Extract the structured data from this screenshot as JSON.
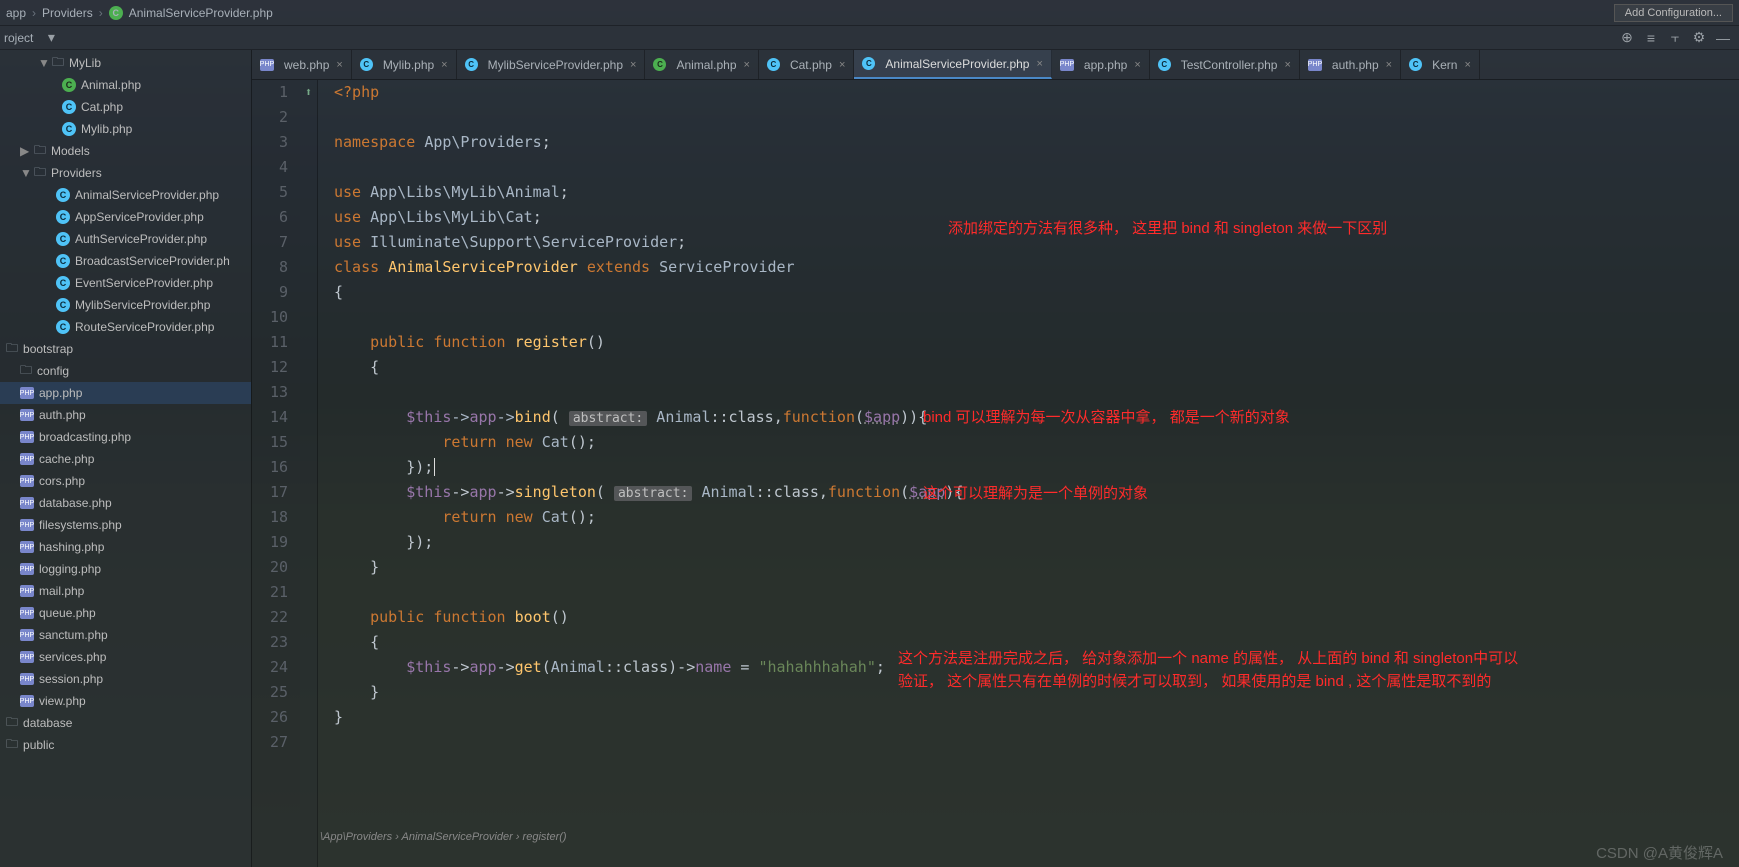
{
  "breadcrumb": {
    "p1": "app",
    "p2": "Providers",
    "p3": "AnimalServiceProvider.php"
  },
  "add_config": "Add Configuration...",
  "project_label": "roject",
  "toolbar_icons": [
    "target-icon",
    "bars-icon",
    "split-icon",
    "gear-icon",
    "hide-icon"
  ],
  "tree": [
    {
      "lvl": 2,
      "chev": "▼",
      "type": "folder",
      "label": "MyLib"
    },
    {
      "lvl": 4,
      "type": "c-green",
      "label": "Animal.php"
    },
    {
      "lvl": 4,
      "type": "c-blue",
      "label": "Cat.php"
    },
    {
      "lvl": 4,
      "type": "c-blue",
      "label": "Mylib.php"
    },
    {
      "lvl": 1,
      "chev": "▶",
      "type": "folder",
      "label": "Models"
    },
    {
      "lvl": 1,
      "chev": "▼",
      "type": "folder",
      "label": "Providers"
    },
    {
      "lvl": 3,
      "type": "c-blue",
      "label": "AnimalServiceProvider.php"
    },
    {
      "lvl": 3,
      "type": "c-blue",
      "label": "AppServiceProvider.php"
    },
    {
      "lvl": 3,
      "type": "c-blue",
      "label": "AuthServiceProvider.php"
    },
    {
      "lvl": 3,
      "type": "c-blue",
      "label": "BroadcastServiceProvider.ph"
    },
    {
      "lvl": 3,
      "type": "c-blue",
      "label": "EventServiceProvider.php"
    },
    {
      "lvl": 3,
      "type": "c-blue",
      "label": "MylibServiceProvider.php"
    },
    {
      "lvl": 3,
      "type": "c-blue",
      "label": "RouteServiceProvider.php"
    },
    {
      "lvl": 0,
      "type": "folder",
      "label": "bootstrap"
    },
    {
      "lvl": 0,
      "chev": "",
      "type": "folder",
      "label": "config"
    },
    {
      "lvl": 1,
      "type": "php",
      "label": "app.php",
      "sel": "cfg-selected"
    },
    {
      "lvl": 1,
      "type": "php",
      "label": "auth.php"
    },
    {
      "lvl": 1,
      "type": "php",
      "label": "broadcasting.php"
    },
    {
      "lvl": 1,
      "type": "php",
      "label": "cache.php"
    },
    {
      "lvl": 1,
      "type": "php",
      "label": "cors.php"
    },
    {
      "lvl": 1,
      "type": "php",
      "label": "database.php"
    },
    {
      "lvl": 1,
      "type": "php",
      "label": "filesystems.php"
    },
    {
      "lvl": 1,
      "type": "php",
      "label": "hashing.php"
    },
    {
      "lvl": 1,
      "type": "php",
      "label": "logging.php"
    },
    {
      "lvl": 1,
      "type": "php",
      "label": "mail.php"
    },
    {
      "lvl": 1,
      "type": "php",
      "label": "queue.php"
    },
    {
      "lvl": 1,
      "type": "php",
      "label": "sanctum.php"
    },
    {
      "lvl": 1,
      "type": "php",
      "label": "services.php"
    },
    {
      "lvl": 1,
      "type": "php",
      "label": "session.php"
    },
    {
      "lvl": 1,
      "type": "php",
      "label": "view.php"
    },
    {
      "lvl": 0,
      "type": "folder",
      "label": "database"
    },
    {
      "lvl": 0,
      "type": "folder",
      "label": "public"
    }
  ],
  "tabs": [
    {
      "icon": "php",
      "label": "web.php"
    },
    {
      "icon": "c-blue",
      "label": "Mylib.php"
    },
    {
      "icon": "c-blue",
      "label": "MylibServiceProvider.php"
    },
    {
      "icon": "c-green",
      "label": "Animal.php"
    },
    {
      "icon": "c-blue",
      "label": "Cat.php"
    },
    {
      "icon": "c-blue",
      "label": "AnimalServiceProvider.php",
      "active": true
    },
    {
      "icon": "php",
      "label": "app.php"
    },
    {
      "icon": "c-blue",
      "label": "TestController.php"
    },
    {
      "icon": "php",
      "label": "auth.php"
    },
    {
      "icon": "c-blue",
      "label": "Kern"
    }
  ],
  "code": {
    "lines": 27,
    "l1_kw": "<?php",
    "l3_ns": "namespace",
    "l3_p": "App\\Providers",
    "l3_sc": ";",
    "l5_use": "use",
    "l5_p": "App\\Libs\\MyLib\\Animal",
    "l5_sc": ";",
    "l6_use": "use",
    "l6_p": "App\\Libs\\MyLib\\Cat",
    "l6_sc": ";",
    "l7_use": "use",
    "l7_p": "Illuminate\\Support\\ServiceProvider",
    "l7_sc": ";",
    "l8_c": "class",
    "l8_n": "AnimalServiceProvider",
    "l8_e": "extends",
    "l8_s": "ServiceProvider",
    "l11_pub": "public",
    "l11_fn": "function",
    "l11_nm": "register",
    "l11_p": "()",
    "l14_this": "$this",
    "l14_arr": "->",
    "l14_app": "app",
    "l14_bind": "bind",
    "l14_hint": "abstract:",
    "l14_an": "Animal",
    "l14_cl": "::class,",
    "l14_fn": "function",
    "l14_ap": "$app",
    "l14_brc": "){",
    "l15_ret": "return",
    "l15_new": "new",
    "l15_cat": "Cat",
    "l15_pp": "();",
    "l17_this": "$this",
    "l17_sg": "singleton",
    "l17_hint": "abstract:",
    "l17_an": "Animal",
    "l17_fn": "function",
    "l17_ap": "$app",
    "l18_ret": "return",
    "l18_new": "new",
    "l18_cat": "Cat",
    "l22_pub": "public",
    "l22_fn": "function",
    "l22_nm": "boot",
    "l22_p": "()",
    "l24_this": "$this",
    "l24_app": "app",
    "l24_get": "get",
    "l24_an": "Animal",
    "l24_cl": "::class)->",
    "l24_name": "name",
    "l24_str": "\"hahahhhahah\""
  },
  "annotations": {
    "a1": "添加绑定的方法有很多种，  这里把 bind   和 singleton 来做一下区别",
    "a2": "bind 可以理解为每一次从容器中拿，  都是一个新的对象",
    "a3": "这个可以理解为是一个单例的对象",
    "a4": "这个方法是注册完成之后，  给对象添加一个 name 的属性，  从上面的 bind 和 singleton中可以验证，  这个属性只有在单例的时候才可以取到，  如果使用的是 bind , 这个属性是取不到的"
  },
  "bottom_bc": "\\App\\Providers  ›  AnimalServiceProvider  ›  register()",
  "csdn": "CSDN @A黄俊辉A"
}
